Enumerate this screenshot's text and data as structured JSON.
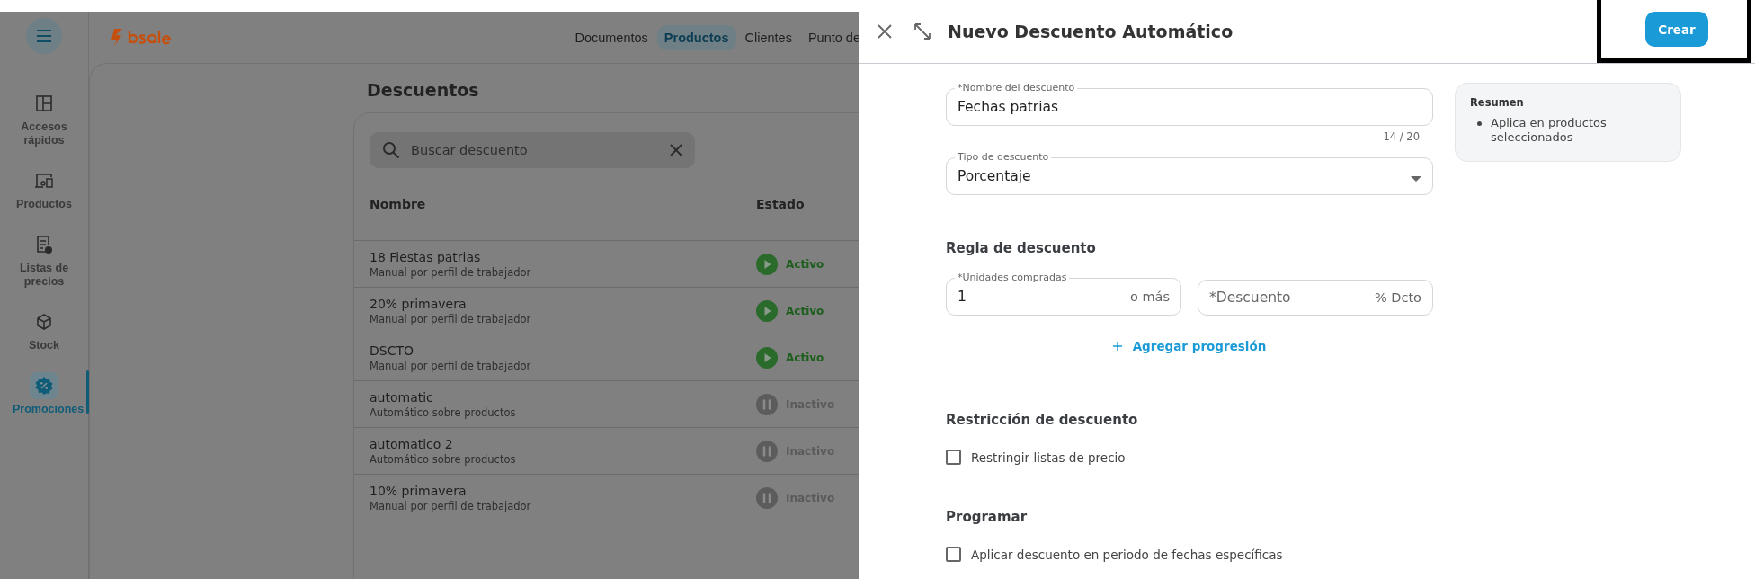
{
  "top_nav": {
    "tabs": [
      {
        "label": "Documentos",
        "selected": false
      },
      {
        "label": "Productos",
        "selected": true
      },
      {
        "label": "Clientes",
        "selected": false
      },
      {
        "label": "Punto de",
        "selected": false
      }
    ]
  },
  "sidebar": {
    "items": [
      {
        "label": "Accesos rápidos",
        "selected": false
      },
      {
        "label": "Productos",
        "selected": false
      },
      {
        "label": "Listas de precios",
        "selected": false
      },
      {
        "label": "Stock",
        "selected": false
      },
      {
        "label": "Promociones",
        "selected": true
      }
    ]
  },
  "page": {
    "title": "Descuentos",
    "search": {
      "placeholder": "Buscar descuento"
    },
    "table": {
      "columns": [
        "Nombre",
        "Estado"
      ],
      "rows": [
        {
          "name": "18 Fiestas patrias",
          "subtitle": "Manual por perfil de trabajador",
          "status": "Activo",
          "active": true
        },
        {
          "name": "20% primavera",
          "subtitle": "Manual por perfil de trabajador",
          "status": "Activo",
          "active": true
        },
        {
          "name": "DSCTO",
          "subtitle": "Manual por perfil de trabajador",
          "status": "Activo",
          "active": true
        },
        {
          "name": "automatic",
          "subtitle": "Automático sobre productos",
          "status": "Inactivo",
          "active": false
        },
        {
          "name": "automatico 2",
          "subtitle": "Automático sobre productos",
          "status": "Inactivo",
          "active": false
        },
        {
          "name": "10% primavera",
          "subtitle": "Manual por perfil de trabajador",
          "status": "Inactivo",
          "active": false
        }
      ]
    }
  },
  "drawer": {
    "title": "Nuevo Descuento Automático",
    "create_button": "Crear",
    "name_field": {
      "label": "*Nombre del descuento",
      "value": "Fechas patrias",
      "counter": "14 / 20"
    },
    "type_field": {
      "label": "Tipo de descuento",
      "value": "Porcentaje"
    },
    "rule": {
      "title": "Regla de descuento",
      "units_field": {
        "label": "*Unidades compradas",
        "value": "1",
        "suffix": "o más"
      },
      "discount_field": {
        "placeholder": "*Descuento",
        "suffix": "% Dcto"
      },
      "add_link": "Agregar progresión"
    },
    "sections": [
      {
        "title": "Restricción de descuento",
        "checkbox": {
          "label": "Restringir listas de precio",
          "checked": false
        }
      },
      {
        "title": "Programar",
        "checkbox": {
          "label": "Aplicar descuento en periodo de fechas específicas",
          "checked": false
        }
      }
    ],
    "summary": {
      "title": "Resumen",
      "items": [
        "Aplica en productos seleccionados"
      ]
    }
  }
}
